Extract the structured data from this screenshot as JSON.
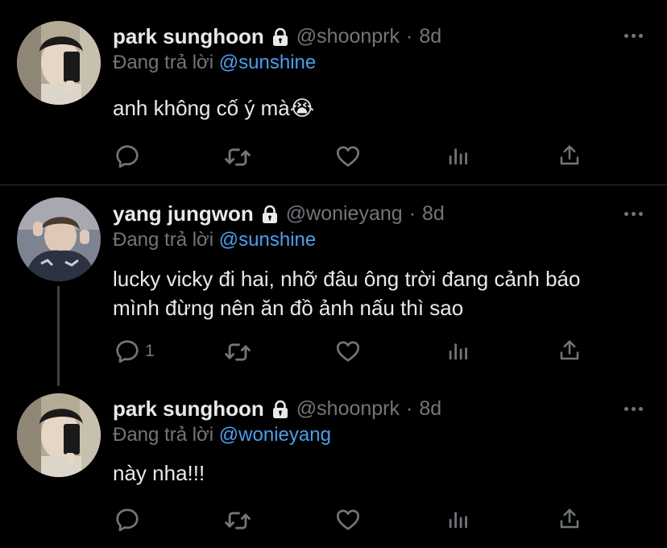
{
  "colors": {
    "background": "#000000",
    "text": "#e7e9ea",
    "muted": "#71767b",
    "mention": "#4d9eeb",
    "divider": "#2f3336"
  },
  "tweets": [
    {
      "name": "park sunghoon",
      "handle": "@shoonprk",
      "separator": "·",
      "time": "8d",
      "replying_prefix": "Đang trả lời",
      "replying_to": "@sunshine",
      "text": "anh không cố ý mà😭",
      "reply_count": "",
      "icons": [
        "lock-icon",
        "more-icon",
        "reply-icon",
        "retweet-icon",
        "like-icon",
        "views-icon",
        "share-icon"
      ]
    },
    {
      "name": "yang jungwon",
      "handle": "@wonieyang",
      "separator": "·",
      "time": "8d",
      "replying_prefix": "Đang trả lời",
      "replying_to": "@sunshine",
      "text": "lucky vicky đi hai, nhỡ đâu ông trời đang cảnh báo mình đừng nên ăn đồ ảnh nấu thì sao",
      "reply_count": "1",
      "icons": [
        "lock-icon",
        "more-icon",
        "reply-icon",
        "retweet-icon",
        "like-icon",
        "views-icon",
        "share-icon"
      ]
    },
    {
      "name": "park sunghoon",
      "handle": "@shoonprk",
      "separator": "·",
      "time": "8d",
      "replying_prefix": "Đang trả lời",
      "replying_to": "@wonieyang",
      "text": "này nha!!!",
      "reply_count": "",
      "icons": [
        "lock-icon",
        "more-icon",
        "reply-icon",
        "retweet-icon",
        "like-icon",
        "views-icon",
        "share-icon"
      ]
    }
  ]
}
